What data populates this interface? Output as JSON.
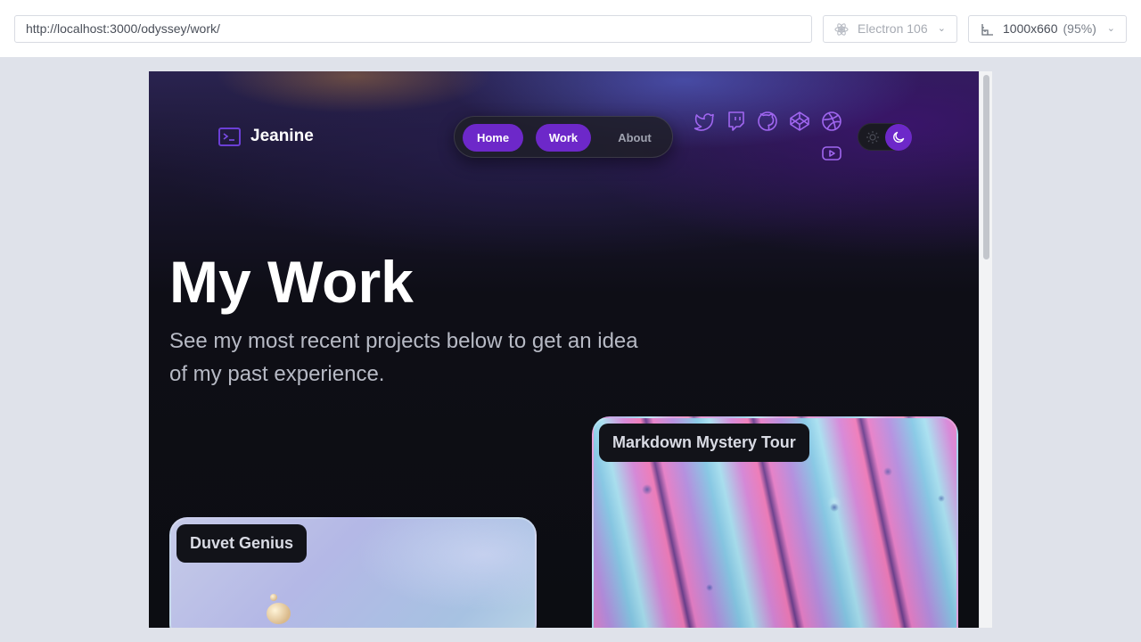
{
  "toolbar": {
    "url": "http://localhost:3000/odyssey/work/",
    "engine": "Electron 106",
    "size": "1000x660",
    "zoom": "(95%)"
  },
  "site": {
    "brand": "Jeanine",
    "nav": [
      {
        "label": "Home",
        "active": true
      },
      {
        "label": "Work",
        "active": true
      },
      {
        "label": "About",
        "active": false
      }
    ],
    "social_icons": [
      "twitter-icon",
      "twitch-icon",
      "github-icon",
      "codepen-icon",
      "dribbble-icon",
      "youtube-icon"
    ],
    "theme_toggle": {
      "mode": "dark"
    },
    "title": "My Work",
    "subtitle": "See my most recent projects below to get an idea of my past experience.",
    "projects": [
      {
        "name": "Duvet Genius"
      },
      {
        "name": "Markdown Mystery Tour"
      }
    ],
    "colors": {
      "accent": "#6d28c9",
      "icon": "#a066f0",
      "background": "#0c0d12"
    }
  }
}
